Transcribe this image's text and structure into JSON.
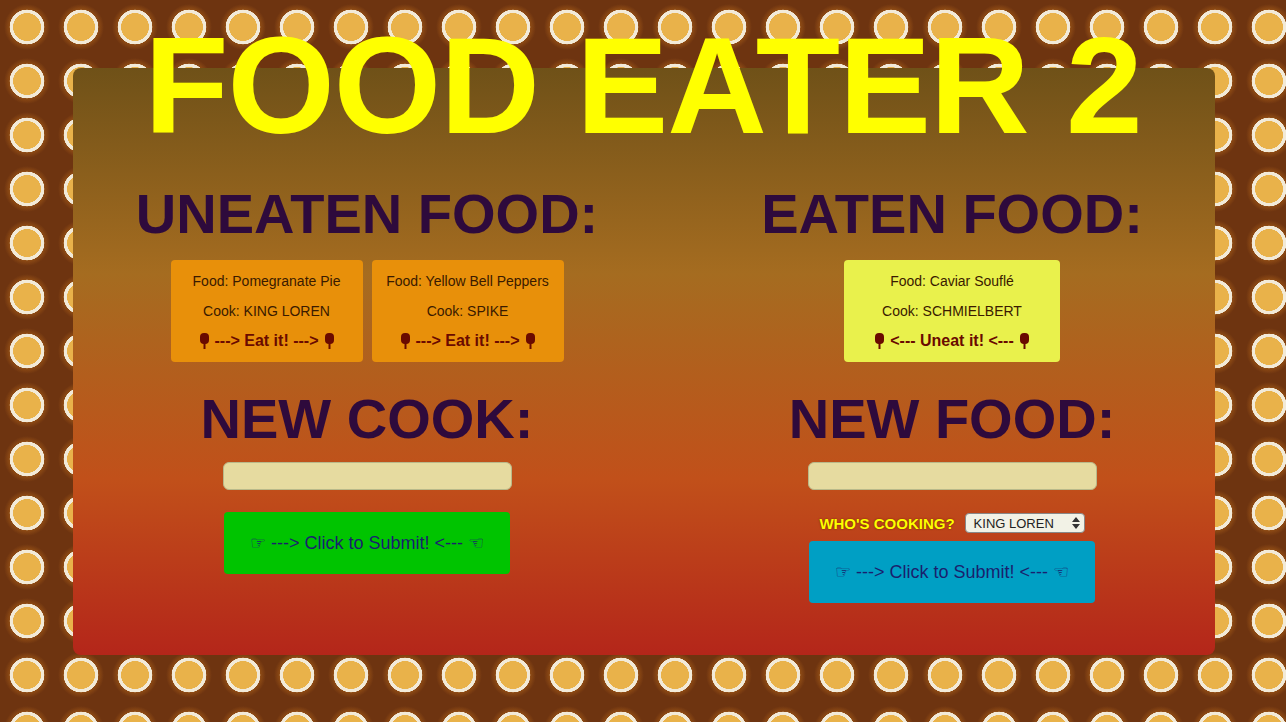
{
  "title": "FOOD EATER 2",
  "uneaten": {
    "heading": "UNEATEN FOOD:",
    "items": [
      {
        "food": "Food: Pomegranate Pie",
        "cook": "Cook: KING LOREN",
        "action": "---> Eat it! --->"
      },
      {
        "food": "Food: Yellow Bell Peppers",
        "cook": "Cook: SPIKE",
        "action": "---> Eat it! --->"
      }
    ]
  },
  "eaten": {
    "heading": "EATEN FOOD:",
    "items": [
      {
        "food": "Food: Caviar Souflé",
        "cook": "Cook: SCHMIELBERT",
        "action": "<--- Uneat it! <---"
      }
    ]
  },
  "new_cook": {
    "heading": "NEW COOK:",
    "button": "☞ ---> Click to Submit! <--- ☜"
  },
  "new_food": {
    "heading": "NEW FOOD:",
    "cooking_label": "WHO'S COOKING?",
    "cook_select": "KING LOREN",
    "button": "☞ ---> Click to Submit! <--- ☜"
  }
}
